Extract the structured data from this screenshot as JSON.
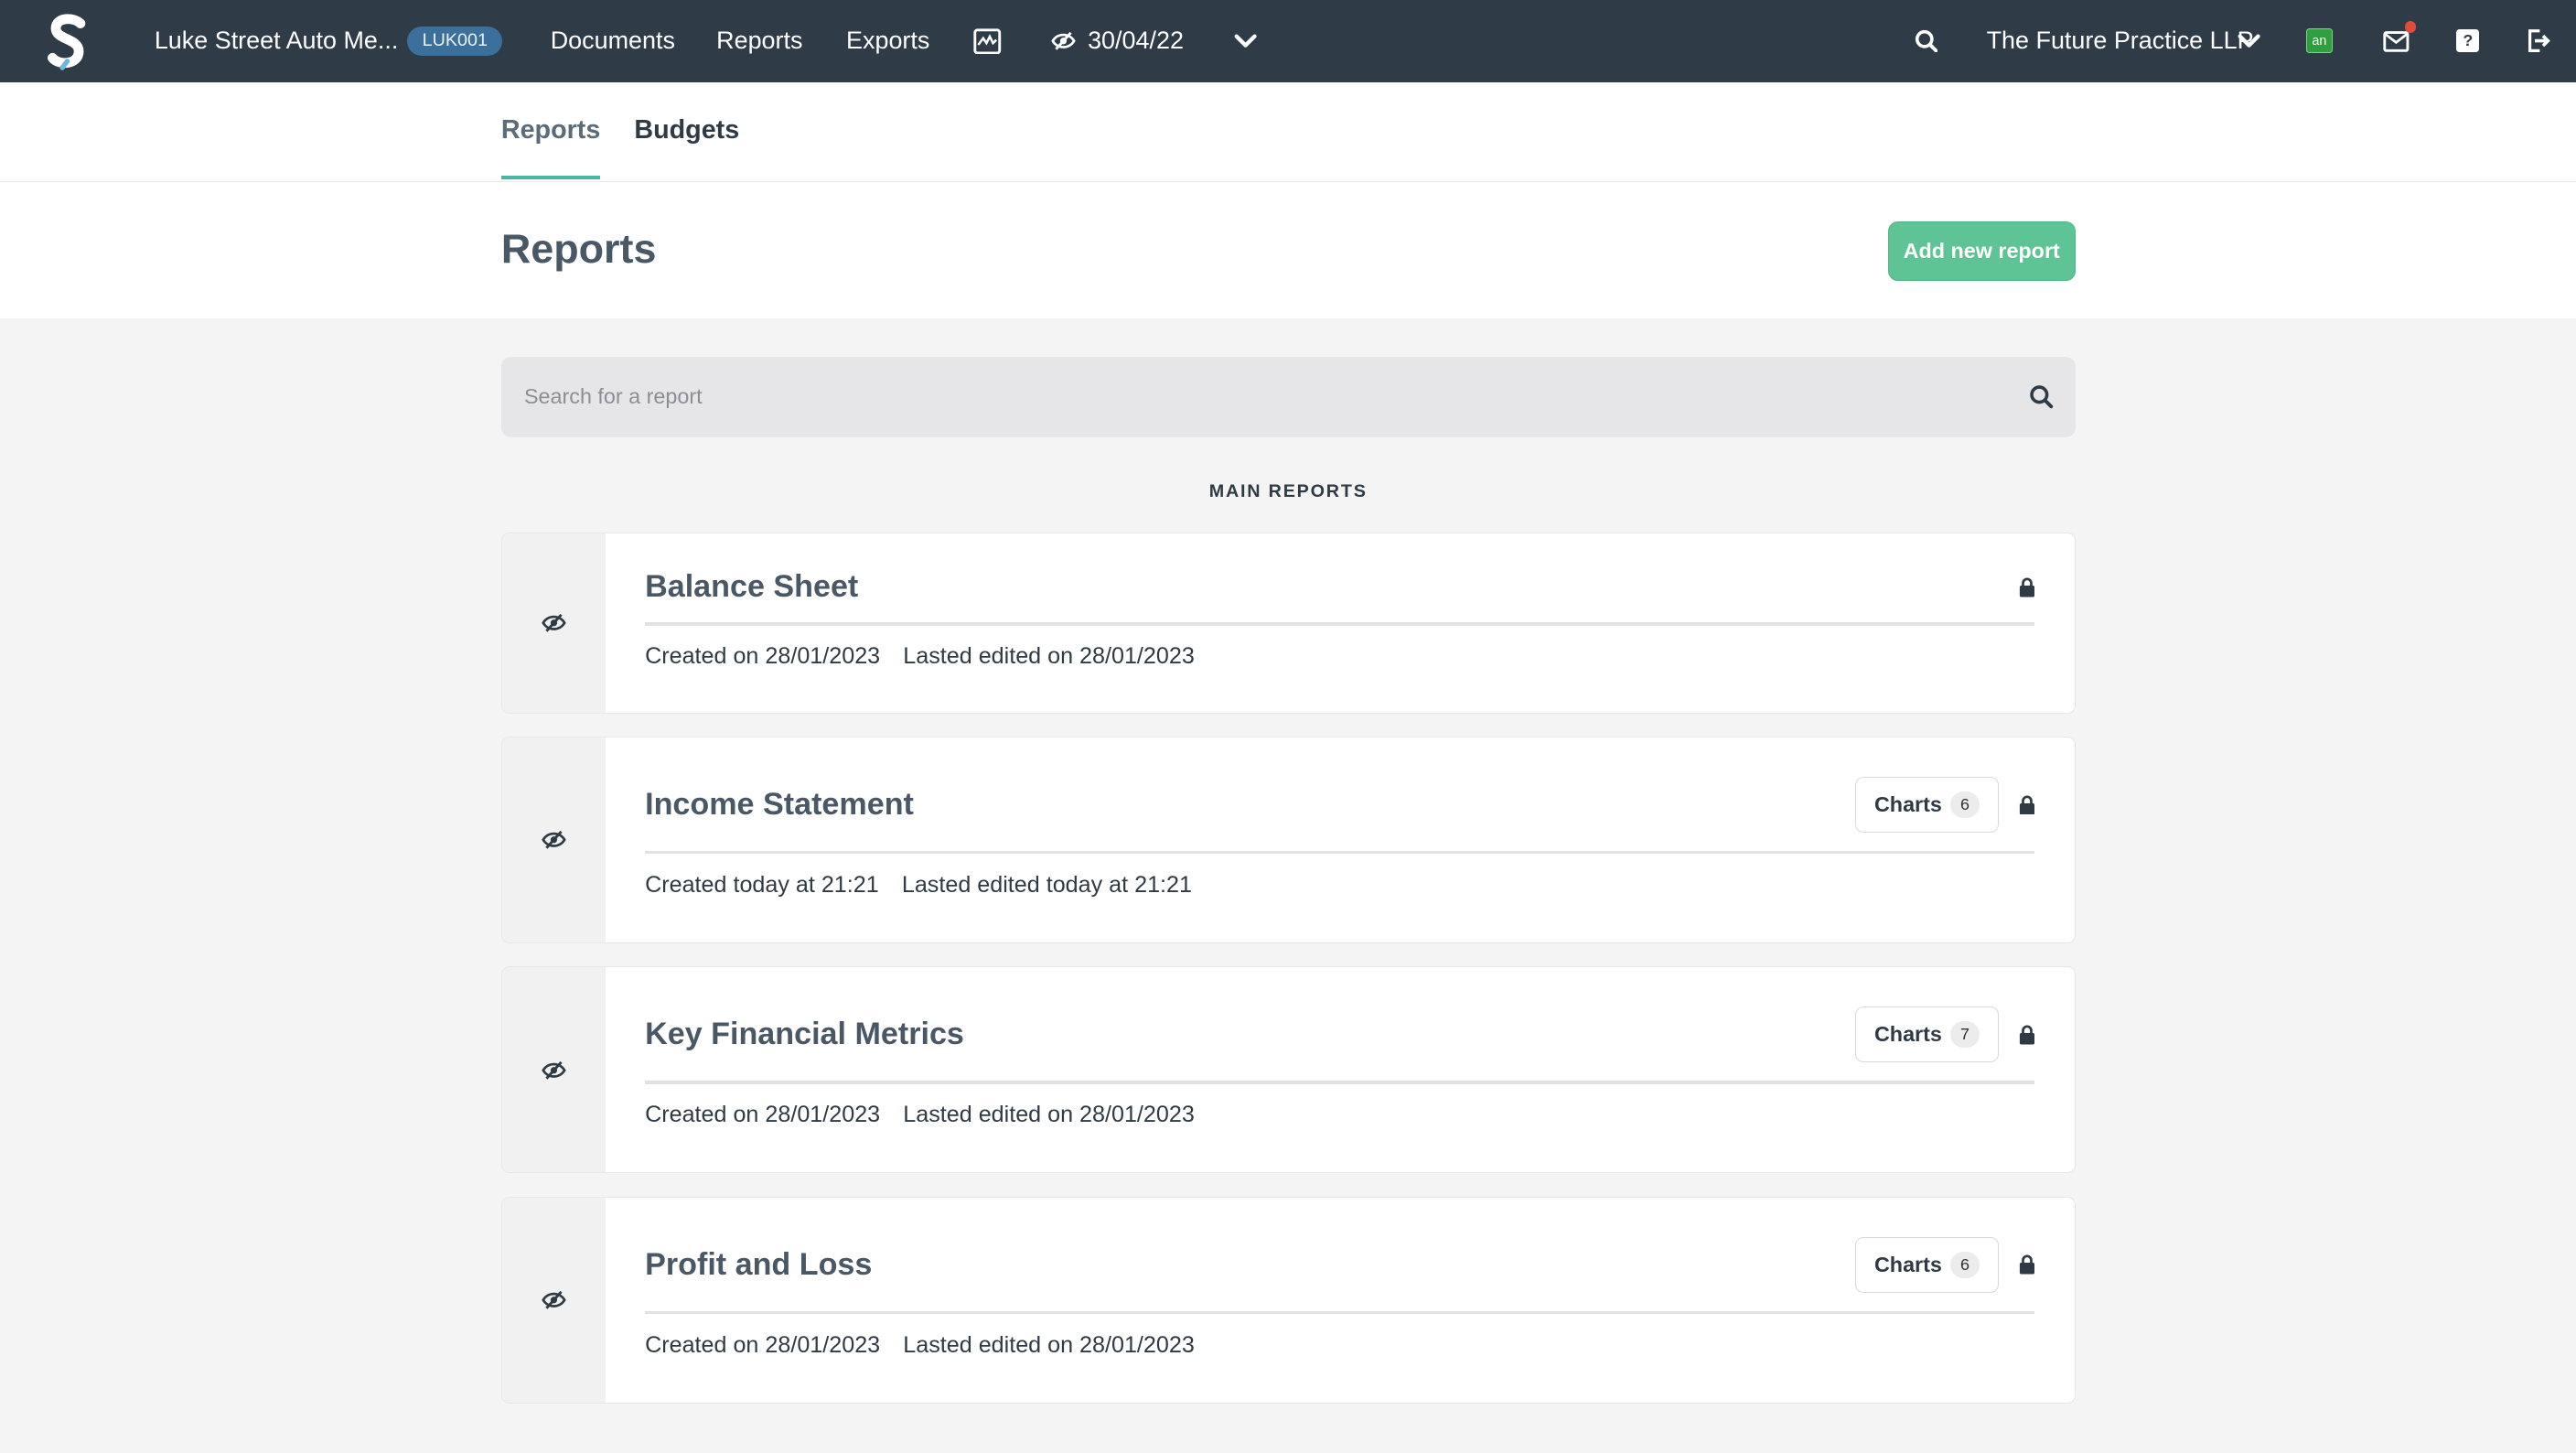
{
  "topnav": {
    "client_name": "Luke Street Auto Me...",
    "client_code": "LUK001",
    "links": [
      "Documents",
      "Reports",
      "Exports"
    ],
    "period": "30/04/22",
    "practice": "The Future Practice LLP",
    "app_badge": "an",
    "help_label": "?"
  },
  "tabs": [
    "Reports",
    "Budgets"
  ],
  "header": {
    "title": "Reports",
    "add_button": "Add new report"
  },
  "search": {
    "placeholder": "Search for a report"
  },
  "section_label": "MAIN REPORTS",
  "reports": [
    {
      "title": "Balance Sheet",
      "created": "Created on 28/01/2023",
      "edited": "Lasted edited on 28/01/2023",
      "charts_label": null,
      "charts_count": null
    },
    {
      "title": "Income Statement",
      "created": "Created today at 21:21",
      "edited": "Lasted edited today at 21:21",
      "charts_label": "Charts",
      "charts_count": "6"
    },
    {
      "title": "Key Financial Metrics",
      "created": "Created on 28/01/2023",
      "edited": "Lasted edited on 28/01/2023",
      "charts_label": "Charts",
      "charts_count": "7"
    },
    {
      "title": "Profit and Loss",
      "created": "Created on 28/01/2023",
      "edited": "Lasted edited on 28/01/2023",
      "charts_label": "Charts",
      "charts_count": "6"
    }
  ],
  "colors": {
    "nav_bg": "#2f3b46",
    "accent": "#5ec496",
    "tab_underline": "#47b7a2",
    "client_badge": "#3b6f9c"
  },
  "icons": {
    "logo": "s-logo-icon",
    "activity": "activity-chart-icon",
    "visibility": "eye-slash-icon",
    "search": "search-icon",
    "mail": "mail-icon",
    "help": "help-icon",
    "logout": "logout-icon",
    "lock": "lock-icon"
  }
}
